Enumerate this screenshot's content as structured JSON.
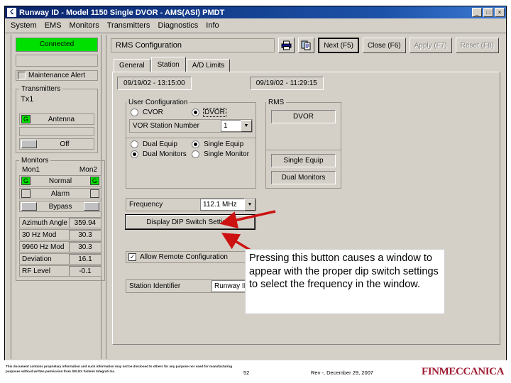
{
  "window": {
    "title": "Runway ID - Model 1150 Single DVOR - AMS(ASI) PMDT",
    "icon": "app-logo-icon",
    "minimize": "_",
    "maximize": "□",
    "close": "×"
  },
  "menubar": {
    "items": [
      {
        "label": "System"
      },
      {
        "label": "EMS"
      },
      {
        "label": "Monitors"
      },
      {
        "label": "Transmitters"
      },
      {
        "label": "Diagnostics"
      },
      {
        "label": "Info"
      }
    ]
  },
  "sidebar": {
    "connection_status": "Connected",
    "secondary_status": "",
    "maintenance_alert_label": "Maintenance Alert",
    "transmitters": {
      "legend": "Transmitters",
      "tx_label": "Tx1",
      "antenna_badge": "G",
      "antenna_label": "Antenna",
      "off_label": "Off"
    },
    "monitors": {
      "legend": "Monitors",
      "mon1": "Mon1",
      "mon2": "Mon2",
      "rows": [
        {
          "label": "Normal",
          "mon1": "G",
          "mon2": "G",
          "state": "on"
        },
        {
          "label": "Alarm",
          "mon1": "",
          "mon2": "",
          "state": "off"
        },
        {
          "label": "Bypass",
          "mon1": "",
          "mon2": "",
          "state": "button"
        }
      ],
      "measurements": [
        {
          "name": "Azimuth Angle",
          "value": "359.94"
        },
        {
          "name": "30 Hz Mod",
          "value": "30.3"
        },
        {
          "name": "9960 Hz Mod",
          "value": "30.3"
        },
        {
          "name": "Deviation",
          "value": "16.1"
        },
        {
          "name": "RF Level",
          "value": "-0.1"
        }
      ]
    }
  },
  "main": {
    "pane_title": "RMS Configuration",
    "toolbar": {
      "print_icon": "printer-icon",
      "copy_icon": "copy-icon",
      "next": "Next (F5)",
      "close": "Close (F6)",
      "apply": "Apply (F7)",
      "reset": "Reset (F8)"
    },
    "tabs": [
      {
        "label": "General",
        "active": false
      },
      {
        "label": "Station",
        "active": true
      },
      {
        "label": "A/D Limits",
        "active": false
      }
    ],
    "dates": {
      "left": "09/19/02 - 13:15:00",
      "right": "09/19/02 - 11:29:15"
    },
    "user_configuration": {
      "legend": "User Configuration",
      "cvor_label": "CVOR",
      "dvor_label": "DVOR",
      "selected_type": "DVOR",
      "station_number_label": "VOR Station Number",
      "station_number_value": "1",
      "dual_equip_label": "Dual Equip",
      "single_equip_label": "Single Equip",
      "selected_equip": "Single Equip",
      "dual_monitors_label": "Dual Monitors",
      "single_monitor_label": "Single Monitor",
      "selected_monitors": "Dual Monitors"
    },
    "rms": {
      "legend": "RMS",
      "type": "DVOR",
      "equip": "Single Equip",
      "monitors": "Dual Monitors"
    },
    "frequency": {
      "label": "Frequency",
      "value": "112.1 MHz"
    },
    "dip_button": "Display DIP Switch Settings",
    "allow_remote": {
      "label": "Allow Remote Configuration",
      "checked": "✓"
    },
    "station_identifier": {
      "label": "Station Identifier",
      "value": "Runway ID"
    }
  },
  "annotation": {
    "callout_text": "Pressing this button causes a window to appear with the proper dip switch settings to select the frequency in the window.",
    "arrow_color": "#cc1111"
  },
  "footer": {
    "disclaimer": "This document contains proprietary information and such information may not be disclosed to others for any purpose nor used for manufacturing purposes without written permission from SELEX Sistemi Integrati Inc.",
    "page_number": "52",
    "revision": "Rev -, December 29, 2007",
    "brand": "FINMECCANICA"
  }
}
